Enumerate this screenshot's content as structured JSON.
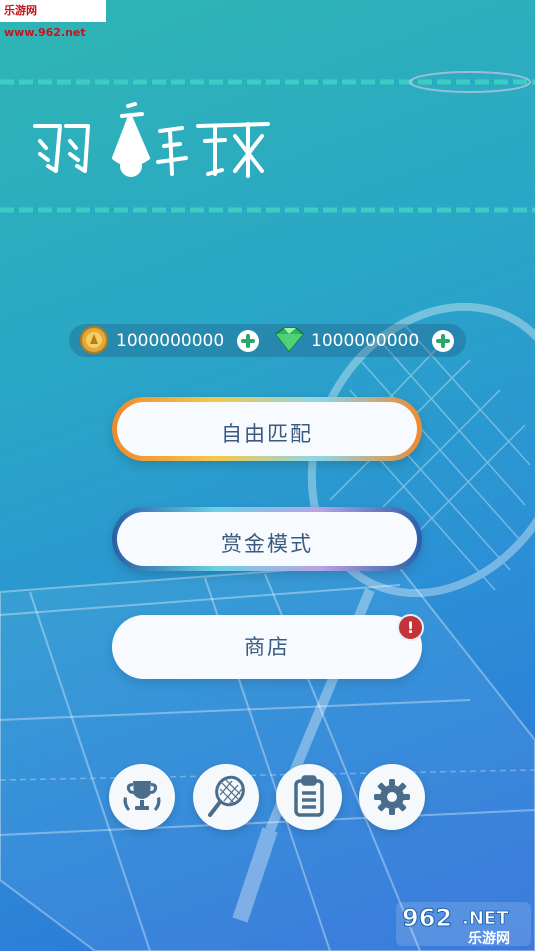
{
  "watermark": {
    "top_text": "乐游网 www.962.net",
    "bottom_main": "962",
    "bottom_net": ".NET",
    "bottom_sub": "乐游网"
  },
  "logo": {
    "title": "羽毛球"
  },
  "currency": {
    "coins": "1000000000",
    "gems": "1000000000",
    "coin_icon": "gold-coin-icon",
    "gem_icon": "green-gem-icon"
  },
  "menu": {
    "free_match": "自由匹配",
    "bounty_mode": "赏金模式",
    "shop": "商店",
    "shop_alert": "!"
  },
  "bottom_bar": {
    "icons": [
      "trophy-icon",
      "racket-icon",
      "clipboard-icon",
      "gear-icon"
    ]
  },
  "colors": {
    "bg_top": "#2fb6b4",
    "bg_bottom": "#2f72db",
    "button_text": "#3a5a80",
    "accent_orange": "#f08a2e",
    "alert_red": "#c4323a",
    "plus_green": "#26a86a"
  }
}
